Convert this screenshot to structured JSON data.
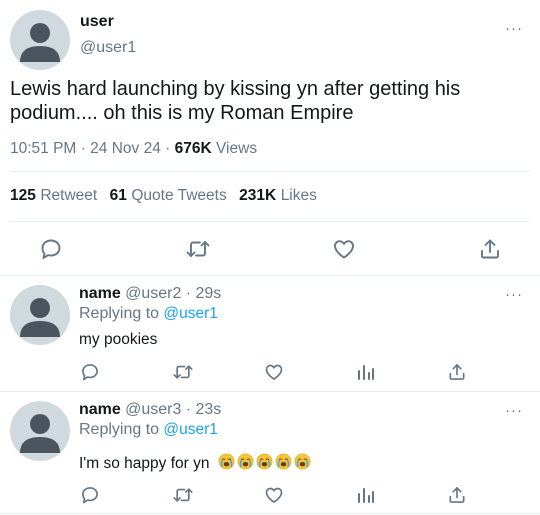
{
  "main_tweet": {
    "name": "user",
    "handle": "@user1",
    "text_line1": "Lewis hard launching by kissing yn after getting his",
    "text_line2": "podium.... oh this is my Roman Empire",
    "time": "10:51 PM",
    "date": "24 Nov 24",
    "separator": "·",
    "views_count": "676K",
    "views_label": "Views",
    "retweets_count": "125",
    "retweets_label": "Retweet",
    "quotes_count": "61",
    "quotes_label": "Quote Tweets",
    "likes_count": "231K",
    "likes_label": "Likes",
    "more": "···"
  },
  "replies": [
    {
      "name": "name",
      "handle": "@user2",
      "time": "· 29s",
      "replying_prefix": "Replying to",
      "replying_to": "@user1",
      "text": "my pookies",
      "more": "···"
    },
    {
      "name": "name",
      "handle": "@user3",
      "time": "· 23s",
      "replying_prefix": "Replying to",
      "replying_to": "@user1",
      "text": "I'm so happy for yn",
      "emoji_count": 5,
      "emoji_name": "loudly-crying-face",
      "more": "···"
    }
  ],
  "colors": {
    "accent": "#1da1f2",
    "secondary_text": "#657786",
    "divider": "#e6ecf0",
    "avatar_bg": "#cfd9de",
    "avatar_fg": "#4a5560"
  }
}
